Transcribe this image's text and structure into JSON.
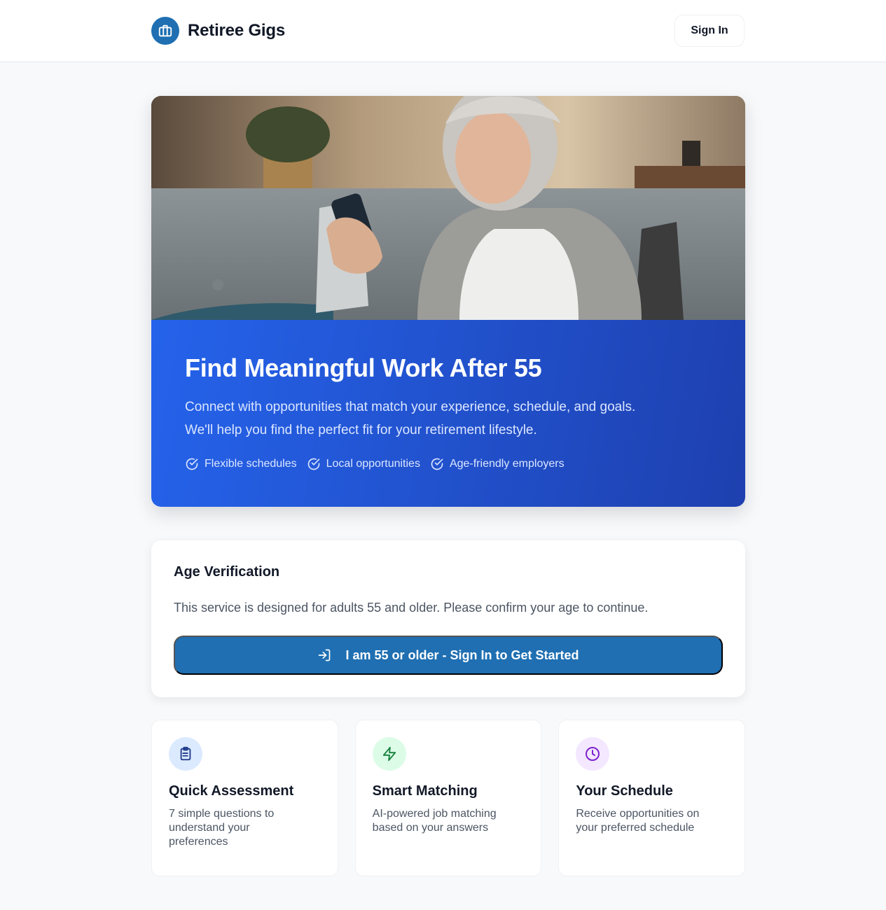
{
  "header": {
    "brand_name": "Retiree Gigs",
    "logo_icon": "briefcase-icon",
    "sign_in_label": "Sign In"
  },
  "hero": {
    "title": "Find Meaningful Work After 55",
    "subtitle_line1": "Connect with opportunities that match your experience, schedule, and goals.",
    "subtitle_line2": "We'll help you find the perfect fit for your retirement lifestyle.",
    "features": [
      {
        "icon": "check-circle-icon",
        "label": "Flexible schedules"
      },
      {
        "icon": "check-circle-icon",
        "label": "Local opportunities"
      },
      {
        "icon": "check-circle-icon",
        "label": "Age-friendly employers"
      }
    ]
  },
  "age_verification": {
    "title": "Age Verification",
    "description": "This service is designed for adults 55 and older. Please confirm your age to continue.",
    "button_label": "I am 55 or older - Sign In to Get Started",
    "button_icon": "sign-in-icon"
  },
  "cards": [
    {
      "icon": "clipboard-icon",
      "title": "Quick Assessment",
      "text": "7 simple questions to understand your preferences",
      "icon_bg": "#dbeafe",
      "icon_color": "#1e3a8a"
    },
    {
      "icon": "lightning-icon",
      "title": "Smart Matching",
      "text": "AI-powered job matching based on your answers",
      "icon_bg": "#dcfce7",
      "icon_color": "#15803d"
    },
    {
      "icon": "clock-icon",
      "title": "Your Schedule",
      "text": "Receive opportunities on your preferred schedule",
      "icon_bg": "#f3e8ff",
      "icon_color": "#7e22ce"
    }
  ],
  "colors": {
    "brand": "#1f6fb2",
    "hero_gradient_start": "#2563eb",
    "hero_gradient_end": "#1e40af",
    "background": "#f8f9fb"
  }
}
